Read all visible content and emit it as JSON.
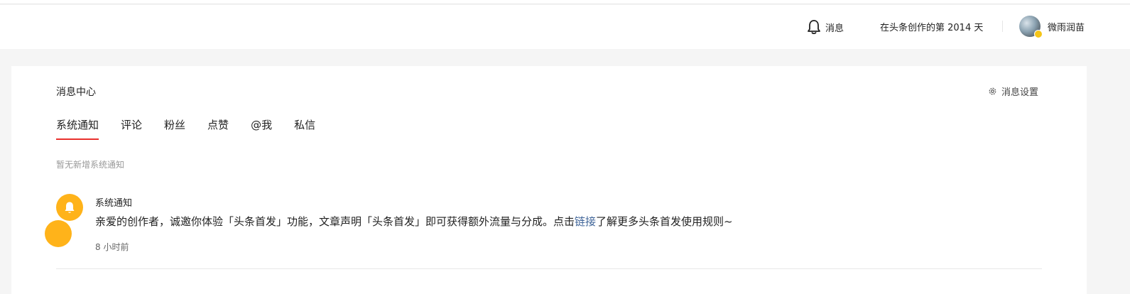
{
  "header": {
    "messages_label": "消息",
    "days_text": "在头条创作的第 2014 天",
    "username": "微雨润苗"
  },
  "main": {
    "title": "消息中心",
    "settings_label": "消息设置",
    "tabs": [
      {
        "label": "系统通知",
        "active": true
      },
      {
        "label": "评论",
        "active": false
      },
      {
        "label": "粉丝",
        "active": false
      },
      {
        "label": "点赞",
        "active": false
      },
      {
        "label": "@我",
        "active": false
      },
      {
        "label": "私信",
        "active": false
      }
    ],
    "empty_text": "暂无新增系统通知",
    "notifications": [
      {
        "title": "系统通知",
        "body_before": "亲爱的创作者，诚邀你体验「头条首发」功能，文章声明「头条首发」即可获得额外流量与分成。点击",
        "link_text": "链接",
        "body_after": "了解更多头条首发使用规则~",
        "time": "8 小时前",
        "icon": "bell-icon"
      }
    ]
  },
  "colors": {
    "accent": "#e9302d",
    "notice_icon_bg": "#ffb31a",
    "link": "#406599"
  }
}
